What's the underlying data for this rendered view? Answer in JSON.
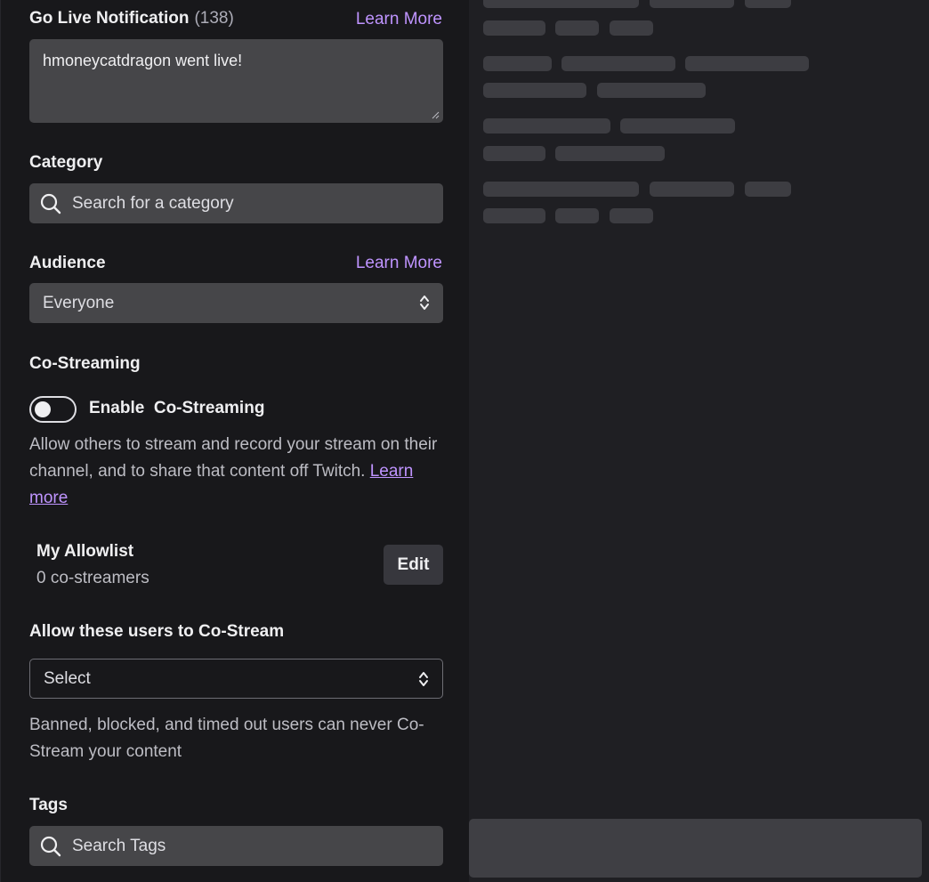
{
  "go_live": {
    "label": "Go Live Notification",
    "count": "(138)",
    "learn_more": "Learn More",
    "value": "hmoneycatdragon went live!"
  },
  "category": {
    "label": "Category",
    "placeholder": "Search for a category",
    "icon": "search-icon"
  },
  "audience": {
    "label": "Audience",
    "learn_more": "Learn More",
    "selected": "Everyone"
  },
  "co_streaming": {
    "label": "Co-Streaming",
    "toggle_label": "Enable  Co-Streaming",
    "toggle_on": false,
    "help_text": "Allow others to stream and record your stream on their channel, and to share that content off Twitch.",
    "help_link": "Learn more"
  },
  "allowlist": {
    "title": "My Allowlist",
    "count": "0 co-streamers",
    "edit": "Edit"
  },
  "allow_users": {
    "label": "Allow these users to Co-Stream",
    "selected": "Select",
    "help_text": "Banned, blocked, and timed out users can never Co-Stream your content"
  },
  "tags": {
    "label": "Tags",
    "placeholder": "Search Tags",
    "icon": "search-icon"
  },
  "colors": {
    "panel": "#18181b",
    "input": "#464649",
    "accent": "#bf94ff",
    "skeleton": "#3d3d42"
  }
}
